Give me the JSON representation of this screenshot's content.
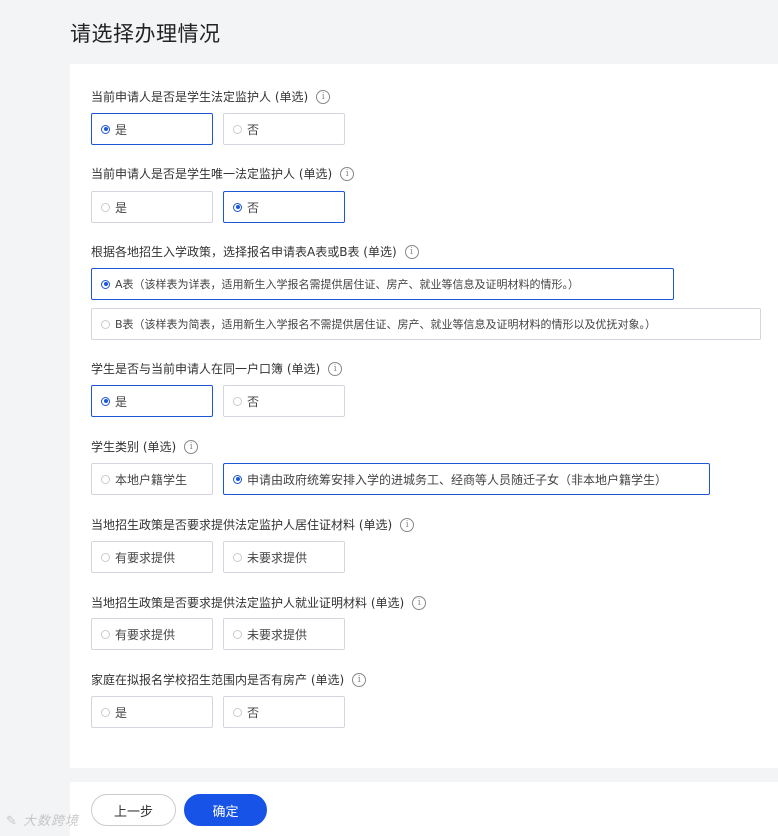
{
  "page_title": "请选择办理情况",
  "info_glyph": "i",
  "questions": [
    {
      "label": "当前申请人是否是学生法定监护人 (单选)",
      "options": [
        "是",
        "否"
      ],
      "selected": 0
    },
    {
      "label": "当前申请人是否是学生唯一法定监护人 (单选)",
      "options": [
        "是",
        "否"
      ],
      "selected": 1
    },
    {
      "label": "根据各地招生入学政策，选择报名申请表A表或B表 (单选)",
      "options": [
        "A表（该样表为详表，适用新生入学报名需提供居住证、房产、就业等信息及证明材料的情形。）",
        "B表（该样表为简表，适用新生入学报名不需提供居住证、房产、就业等信息及证明材料的情形以及优抚对象。）"
      ],
      "selected": 0
    },
    {
      "label": "学生是否与当前申请人在同一户口簿 (单选)",
      "options": [
        "是",
        "否"
      ],
      "selected": 0
    },
    {
      "label": "学生类别 (单选)",
      "options": [
        "本地户籍学生",
        "申请由政府统筹安排入学的进城务工、经商等人员随迁子女（非本地户籍学生）"
      ],
      "selected": 1
    },
    {
      "label": "当地招生政策是否要求提供法定监护人居住证材料 (单选)",
      "options": [
        "有要求提供",
        "未要求提供"
      ],
      "selected": null
    },
    {
      "label": "当地招生政策是否要求提供法定监护人就业证明材料 (单选)",
      "options": [
        "有要求提供",
        "未要求提供"
      ],
      "selected": null
    },
    {
      "label": "家庭在拟报名学校招生范围内是否有房产 (单选)",
      "options": [
        "是",
        "否"
      ],
      "selected": null
    }
  ],
  "buttons": {
    "prev": "上一步",
    "confirm": "确定"
  },
  "watermark": "大数跨境",
  "colors": {
    "accent": "#1753e6",
    "border": "#d3d6dc",
    "background": "#f3f4f6"
  }
}
